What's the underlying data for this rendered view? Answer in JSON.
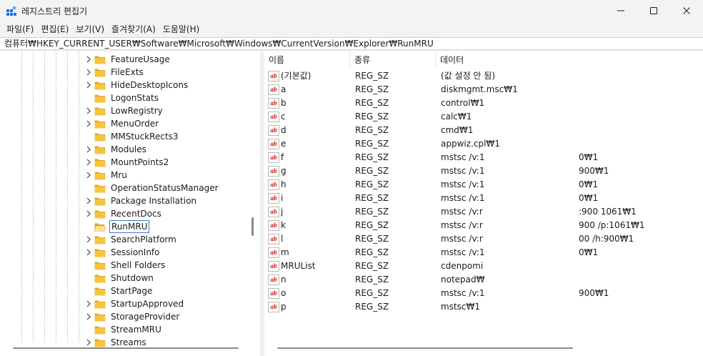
{
  "window": {
    "title": "레지스트리 편집기",
    "minimize_glyph": "—",
    "maximize_glyph": "☐",
    "close_glyph": "✕"
  },
  "menu": [
    "파일(F)",
    "편집(E)",
    "보기(V)",
    "즐겨찾기(A)",
    "도움말(H)"
  ],
  "address": "컴퓨터₩HKEY_CURRENT_USER₩Software₩Microsoft₩Windows₩CurrentVersion₩Explorer₩RunMRU",
  "tree": {
    "items": [
      {
        "label": "FeatureUsage",
        "expandable": true
      },
      {
        "label": "FileExts",
        "expandable": true
      },
      {
        "label": "HideDesktopIcons",
        "expandable": true
      },
      {
        "label": "LogonStats",
        "expandable": false
      },
      {
        "label": "LowRegistry",
        "expandable": true
      },
      {
        "label": "MenuOrder",
        "expandable": true
      },
      {
        "label": "MMStuckRects3",
        "expandable": false
      },
      {
        "label": "Modules",
        "expandable": true
      },
      {
        "label": "MountPoints2",
        "expandable": true
      },
      {
        "label": "Mru",
        "expandable": true
      },
      {
        "label": "OperationStatusManager",
        "expandable": false
      },
      {
        "label": "Package Installation",
        "expandable": true
      },
      {
        "label": "RecentDocs",
        "expandable": true
      },
      {
        "label": "RunMRU",
        "expandable": false,
        "selected": true
      },
      {
        "label": "SearchPlatform",
        "expandable": true
      },
      {
        "label": "SessionInfo",
        "expandable": true
      },
      {
        "label": "Shell Folders",
        "expandable": false
      },
      {
        "label": "Shutdown",
        "expandable": false
      },
      {
        "label": "StartPage",
        "expandable": false
      },
      {
        "label": "StartupApproved",
        "expandable": true
      },
      {
        "label": "StorageProvider",
        "expandable": true
      },
      {
        "label": "StreamMRU",
        "expandable": false
      },
      {
        "label": "Streams",
        "expandable": true
      }
    ]
  },
  "list": {
    "columns": [
      "이름",
      "종류",
      "데이터"
    ],
    "rows": [
      {
        "name": "(기본값)",
        "type": "REG_SZ",
        "data": "(값 설정 안 됨)"
      },
      {
        "name": "a",
        "type": "REG_SZ",
        "data": "diskmgmt.msc₩1"
      },
      {
        "name": "b",
        "type": "REG_SZ",
        "data": "control₩1"
      },
      {
        "name": "c",
        "type": "REG_SZ",
        "data": "calc₩1"
      },
      {
        "name": "d",
        "type": "REG_SZ",
        "data": "cmd₩1"
      },
      {
        "name": "e",
        "type": "REG_SZ",
        "data": "appwiz.cpl₩1"
      },
      {
        "name": "f",
        "type": "REG_SZ",
        "data": "mstsc /v:1",
        "data_tail": "0₩1"
      },
      {
        "name": "g",
        "type": "REG_SZ",
        "data": "mstsc /v:1",
        "data_tail": "900₩1"
      },
      {
        "name": "h",
        "type": "REG_SZ",
        "data": "mstsc /v:1",
        "data_tail": "0₩1"
      },
      {
        "name": "i",
        "type": "REG_SZ",
        "data": "mstsc /v:1",
        "data_tail": "0₩1"
      },
      {
        "name": "j",
        "type": "REG_SZ",
        "data": "mstsc /v:r",
        "data_tail": ":900 1061₩1"
      },
      {
        "name": "k",
        "type": "REG_SZ",
        "data": "mstsc /v:r",
        "data_tail": "900 /p:1061₩1"
      },
      {
        "name": "l",
        "type": "REG_SZ",
        "data": "mstsc /v:r",
        "data_tail": "00 /h:900₩1"
      },
      {
        "name": "m",
        "type": "REG_SZ",
        "data": "mstsc /v:1",
        "data_tail": "0₩1"
      },
      {
        "name": "MRUList",
        "type": "REG_SZ",
        "data": "cdenpomi",
        "data_tail": ""
      },
      {
        "name": "n",
        "type": "REG_SZ",
        "data": "notepad₩",
        "data_tail": ""
      },
      {
        "name": "o",
        "type": "REG_SZ",
        "data": "mstsc /v:1",
        "data_tail": "900₩1"
      },
      {
        "name": "p",
        "type": "REG_SZ",
        "data": "mstsc₩1"
      }
    ]
  },
  "icons": {
    "app": "registry-editor-icon",
    "folder": "folder-icon",
    "value": "string-value-icon",
    "chevron": "chevron-right-icon"
  },
  "colors": {
    "folder": "#f4c542",
    "folder_dark": "#e0a82e",
    "selection_border": "#3b7ad7",
    "value_icon_text": "#cc1111"
  }
}
